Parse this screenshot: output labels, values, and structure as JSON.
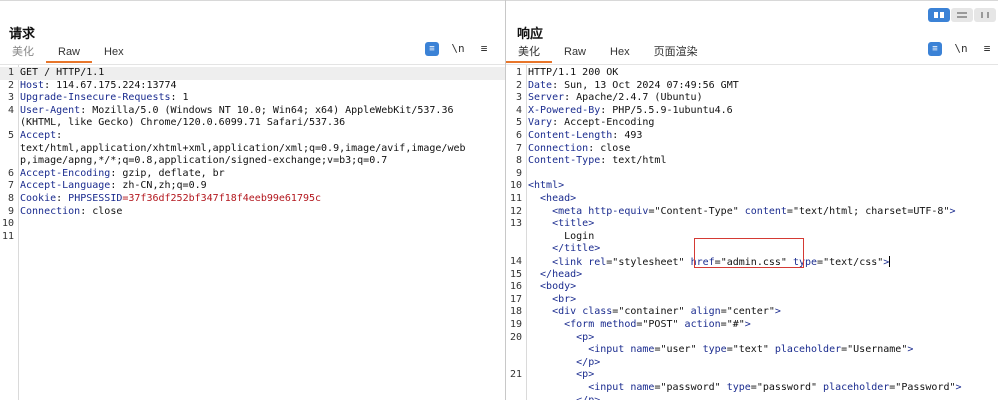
{
  "request": {
    "title": "请求",
    "tabs": [
      "美化",
      "Raw",
      "Hex"
    ],
    "tools": {
      "wrap_icon": "≡",
      "newline": "\\n",
      "menu": "≡"
    },
    "lines": [
      {
        "n": "1",
        "parts": [
          {
            "t": "GET / HTTP/1.1",
            "c": "plain"
          }
        ]
      },
      {
        "n": "2",
        "parts": [
          {
            "t": "Host",
            "c": "hdr"
          },
          {
            "t": ": 114.67.175.224:13774",
            "c": "plain"
          }
        ]
      },
      {
        "n": "3",
        "parts": [
          {
            "t": "Upgrade-Insecure-Requests",
            "c": "hdr"
          },
          {
            "t": ": 1",
            "c": "plain"
          }
        ]
      },
      {
        "n": "4",
        "parts": [
          {
            "t": "User-Agent",
            "c": "hdr"
          },
          {
            "t": ": Mozilla/5.0 (Windows NT 10.0; Win64; x64) AppleWebKit/537.36",
            "c": "plain"
          }
        ]
      },
      {
        "n": "",
        "parts": [
          {
            "t": "(KHTML, like Gecko) Chrome/120.0.6099.71 Safari/537.36",
            "c": "plain"
          }
        ]
      },
      {
        "n": "5",
        "parts": [
          {
            "t": "Accept",
            "c": "hdr"
          },
          {
            "t": ":",
            "c": "plain"
          }
        ]
      },
      {
        "n": "",
        "parts": [
          {
            "t": "text/html,application/xhtml+xml,application/xml;q=0.9,image/avif,image/web",
            "c": "plain"
          }
        ]
      },
      {
        "n": "",
        "parts": [
          {
            "t": "p,image/apng,*/*;q=0.8,application/signed-exchange;v=b3;q=0.7",
            "c": "plain"
          }
        ]
      },
      {
        "n": "6",
        "parts": [
          {
            "t": "Accept-Encoding",
            "c": "hdr"
          },
          {
            "t": ": gzip, deflate, br",
            "c": "plain"
          }
        ]
      },
      {
        "n": "7",
        "parts": [
          {
            "t": "Accept-Language",
            "c": "hdr"
          },
          {
            "t": ": zh-CN,zh;q=0.9",
            "c": "plain"
          }
        ]
      },
      {
        "n": "8",
        "parts": [
          {
            "t": "Cookie",
            "c": "hdr"
          },
          {
            "t": ": ",
            "c": "plain"
          },
          {
            "t": "PHPSESSID",
            "c": "ckn"
          },
          {
            "t": "=37f36df252bf347f18f4eeb99e61795c",
            "c": "ckv"
          }
        ]
      },
      {
        "n": "9",
        "parts": [
          {
            "t": "Connection",
            "c": "hdr"
          },
          {
            "t": ": close",
            "c": "plain"
          }
        ]
      },
      {
        "n": "10",
        "parts": []
      },
      {
        "n": "11",
        "parts": []
      }
    ]
  },
  "response": {
    "title": "响应",
    "tabs": [
      "美化",
      "Raw",
      "Hex",
      "页面渲染"
    ],
    "tools": {
      "wrap_icon": "≡",
      "newline": "\\n",
      "menu": "≡"
    },
    "lines": [
      {
        "n": "1",
        "parts": [
          {
            "t": "HTTP/1.1 200 OK",
            "c": "plain"
          }
        ]
      },
      {
        "n": "2",
        "parts": [
          {
            "t": "Date",
            "c": "hdr"
          },
          {
            "t": ": Sun, 13 Oct 2024 07:49:56 GMT",
            "c": "plain"
          }
        ]
      },
      {
        "n": "3",
        "parts": [
          {
            "t": "Server",
            "c": "hdr"
          },
          {
            "t": ": Apache/2.4.7 (Ubuntu)",
            "c": "plain"
          }
        ]
      },
      {
        "n": "4",
        "parts": [
          {
            "t": "X-Powered-By",
            "c": "hdr"
          },
          {
            "t": ": PHP/5.5.9-1ubuntu4.6",
            "c": "plain"
          }
        ]
      },
      {
        "n": "5",
        "parts": [
          {
            "t": "Vary",
            "c": "hdr"
          },
          {
            "t": ": Accept-Encoding",
            "c": "plain"
          }
        ]
      },
      {
        "n": "6",
        "parts": [
          {
            "t": "Content-Length",
            "c": "hdr"
          },
          {
            "t": ": 493",
            "c": "plain"
          }
        ]
      },
      {
        "n": "7",
        "parts": [
          {
            "t": "Connection",
            "c": "hdr"
          },
          {
            "t": ": close",
            "c": "plain"
          }
        ]
      },
      {
        "n": "8",
        "parts": [
          {
            "t": "Content-Type",
            "c": "hdr"
          },
          {
            "t": ": text/html",
            "c": "plain"
          }
        ]
      },
      {
        "n": "9",
        "parts": []
      },
      {
        "n": "10",
        "parts": [
          {
            "t": "<html>",
            "c": "tag"
          }
        ]
      },
      {
        "n": "11",
        "parts": [
          {
            "t": "  <head>",
            "c": "tag"
          }
        ]
      },
      {
        "n": "12",
        "parts": [
          {
            "t": "    <meta ",
            "c": "tag"
          },
          {
            "t": "http-equiv",
            "c": "attr"
          },
          {
            "t": "=\"Content-Type\" ",
            "c": "plain"
          },
          {
            "t": "content",
            "c": "attr"
          },
          {
            "t": "=\"text/html; charset=UTF-8\"",
            "c": "plain"
          },
          {
            "t": ">",
            "c": "tag"
          }
        ]
      },
      {
        "n": "13",
        "parts": [
          {
            "t": "    <title>",
            "c": "tag"
          }
        ]
      },
      {
        "n": "",
        "parts": [
          {
            "t": "      Login",
            "c": "plain"
          }
        ]
      },
      {
        "n": "",
        "parts": [
          {
            "t": "    </title>",
            "c": "tag"
          }
        ]
      },
      {
        "n": "14",
        "parts": [
          {
            "t": "    <link ",
            "c": "tag"
          },
          {
            "t": "rel",
            "c": "attr"
          },
          {
            "t": "=\"stylesheet\" ",
            "c": "plain"
          },
          {
            "t": "href",
            "c": "attr"
          },
          {
            "t": "=\"admin.css\" ",
            "c": "plain"
          },
          {
            "t": "type",
            "c": "attr"
          },
          {
            "t": "=\"text/css\"",
            "c": "plain"
          },
          {
            "t": ">",
            "c": "tag"
          }
        ],
        "caret": true
      },
      {
        "n": "15",
        "parts": [
          {
            "t": "  </head>",
            "c": "tag"
          }
        ]
      },
      {
        "n": "16",
        "parts": [
          {
            "t": "  <body>",
            "c": "tag"
          }
        ]
      },
      {
        "n": "17",
        "parts": [
          {
            "t": "    <br>",
            "c": "tag"
          }
        ]
      },
      {
        "n": "18",
        "parts": [
          {
            "t": "    <div ",
            "c": "tag"
          },
          {
            "t": "class",
            "c": "attr"
          },
          {
            "t": "=\"container\" ",
            "c": "plain"
          },
          {
            "t": "align",
            "c": "attr"
          },
          {
            "t": "=\"center\"",
            "c": "plain"
          },
          {
            "t": ">",
            "c": "tag"
          }
        ]
      },
      {
        "n": "19",
        "parts": [
          {
            "t": "      <form ",
            "c": "tag"
          },
          {
            "t": "method",
            "c": "attr"
          },
          {
            "t": "=\"POST\" ",
            "c": "plain"
          },
          {
            "t": "action",
            "c": "attr"
          },
          {
            "t": "=\"#\"",
            "c": "plain"
          },
          {
            "t": ">",
            "c": "tag"
          }
        ]
      },
      {
        "n": "20",
        "parts": [
          {
            "t": "        <p>",
            "c": "tag"
          }
        ]
      },
      {
        "n": "",
        "parts": [
          {
            "t": "          <input ",
            "c": "tag"
          },
          {
            "t": "name",
            "c": "attr"
          },
          {
            "t": "=\"user\" ",
            "c": "plain"
          },
          {
            "t": "type",
            "c": "attr"
          },
          {
            "t": "=\"text\" ",
            "c": "plain"
          },
          {
            "t": "placeholder",
            "c": "attr"
          },
          {
            "t": "=\"Username\"",
            "c": "plain"
          },
          {
            "t": ">",
            "c": "tag"
          }
        ]
      },
      {
        "n": "",
        "parts": [
          {
            "t": "        </p>",
            "c": "tag"
          }
        ]
      },
      {
        "n": "21",
        "parts": [
          {
            "t": "        <p>",
            "c": "tag"
          }
        ]
      },
      {
        "n": "",
        "parts": [
          {
            "t": "          <input ",
            "c": "tag"
          },
          {
            "t": "name",
            "c": "attr"
          },
          {
            "t": "=\"password\" ",
            "c": "plain"
          },
          {
            "t": "type",
            "c": "attr"
          },
          {
            "t": "=\"password\" ",
            "c": "plain"
          },
          {
            "t": "placeholder",
            "c": "attr"
          },
          {
            "t": "=\"Password\"",
            "c": "plain"
          },
          {
            "t": ">",
            "c": "tag"
          }
        ]
      },
      {
        "n": "",
        "parts": [
          {
            "t": "        </p>",
            "c": "tag"
          }
        ]
      }
    ]
  }
}
